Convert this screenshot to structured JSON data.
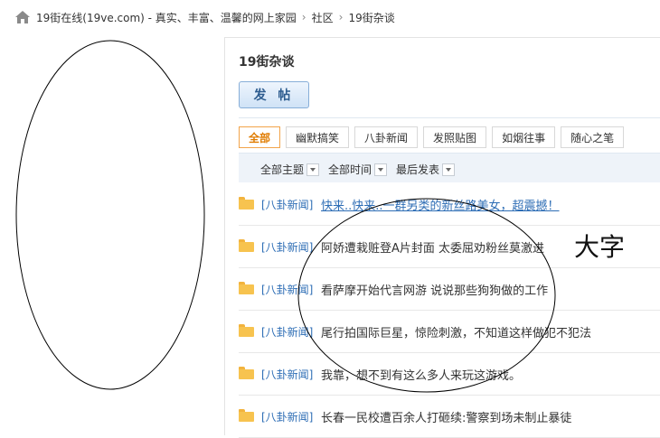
{
  "breadcrumb": {
    "items": [
      "19街在线(19ve.com) - 真实、丰富、温馨的网上家园",
      "社区",
      "19街杂谈"
    ],
    "separator": "›"
  },
  "forum": {
    "title": "19街杂谈",
    "post_button": "发 帖"
  },
  "tabs": [
    "全部",
    "幽默搞笑",
    "八卦新闻",
    "发照贴图",
    "如烟往事",
    "随心之笔"
  ],
  "filters": {
    "topics": "全部主题",
    "time": "全部时间",
    "sort": "最后发表"
  },
  "threads": [
    {
      "category": "[八卦新闻]",
      "title": "快来..快来..一群另类的新丝路美女，超震撼！"
    },
    {
      "category": "[八卦新闻]",
      "title": "阿娇遭栽赃登A片封面  太委屈劝粉丝莫激进"
    },
    {
      "category": "[八卦新闻]",
      "title": "看萨摩开始代言网游  说说那些狗狗做的工作"
    },
    {
      "category": "[八卦新闻]",
      "title": "尾行拍国际巨星，惊险刺激，不知道这样做犯不犯法"
    },
    {
      "category": "[八卦新闻]",
      "title": "我靠，想不到有这么多人来玩这游戏。"
    },
    {
      "category": "[八卦新闻]",
      "title": "长春一民校遭百余人打砸续:警察到场未制止暴徒"
    }
  ],
  "annotation": {
    "text": "大字"
  },
  "colors": {
    "link": "#2d6db5",
    "active_tab": "#e07c00",
    "folder": "#f7c34f"
  }
}
